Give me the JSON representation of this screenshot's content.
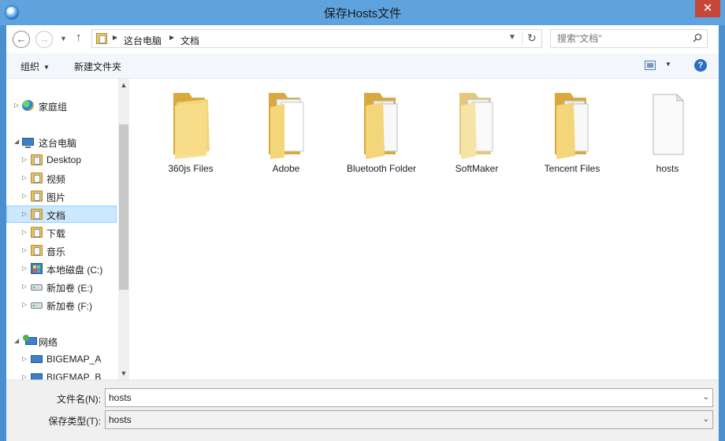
{
  "window": {
    "title": "保存Hosts文件",
    "close_glyph": "✕"
  },
  "address": {
    "breadcrumbs": [
      "这台电脑",
      "文档"
    ],
    "search_placeholder": "搜索\"文档\""
  },
  "toolbar": {
    "organize": "组织",
    "new_folder": "新建文件夹",
    "help_glyph": "?"
  },
  "nav": {
    "items": [
      {
        "label": "家庭组",
        "icon": "homegroup-icon",
        "expanded": false
      },
      {
        "label": "这台电脑",
        "icon": "computer-icon",
        "expanded": true
      },
      {
        "label": "Desktop",
        "icon": "folder-icon",
        "expanded": false
      },
      {
        "label": "视频",
        "icon": "folder-icon",
        "expanded": false
      },
      {
        "label": "图片",
        "icon": "folder-icon",
        "expanded": false
      },
      {
        "label": "文档",
        "icon": "folder-icon",
        "expanded": false,
        "selected": true
      },
      {
        "label": "下载",
        "icon": "folder-icon",
        "expanded": false
      },
      {
        "label": "音乐",
        "icon": "folder-icon",
        "expanded": false
      },
      {
        "label": "本地磁盘 (C:)",
        "icon": "system-drive-icon",
        "expanded": false
      },
      {
        "label": "新加卷 (E:)",
        "icon": "drive-icon",
        "expanded": false
      },
      {
        "label": "新加卷 (F:)",
        "icon": "drive-icon",
        "expanded": false
      },
      {
        "label": "网络",
        "icon": "network-icon",
        "expanded": true
      },
      {
        "label": "BIGEMAP_A",
        "icon": "network-computer-icon",
        "expanded": false
      },
      {
        "label": "BIGEMAP_B",
        "icon": "network-computer-icon",
        "expanded": false
      }
    ]
  },
  "files": [
    {
      "name": "360js Files",
      "type": "folder"
    },
    {
      "name": "Adobe",
      "type": "folder"
    },
    {
      "name": "Bluetooth Folder",
      "type": "folder"
    },
    {
      "name": "SoftMaker",
      "type": "folder"
    },
    {
      "name": "Tencent Files",
      "type": "folder"
    },
    {
      "name": "hosts",
      "type": "file"
    }
  ],
  "form": {
    "filename_label": "文件名(N):",
    "filename_value": "hosts",
    "filetype_label": "保存类型(T):",
    "filetype_value": "hosts"
  },
  "colors": {
    "titlebar": "#5fa3de",
    "close": "#c7463a",
    "selection": "#cce8ff",
    "folder": "#e8c15a"
  }
}
